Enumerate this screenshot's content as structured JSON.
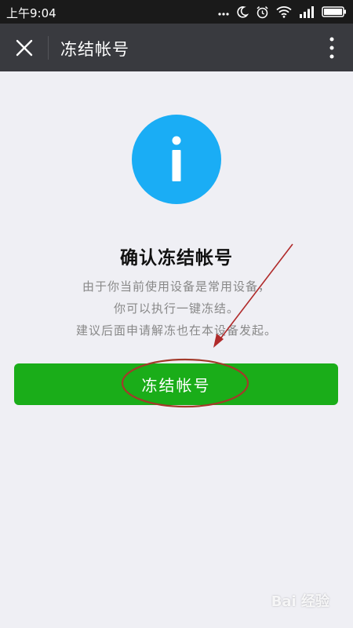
{
  "status_bar": {
    "time": "上午9:04",
    "icons": [
      "ellipsis-icon",
      "moon-icon",
      "alarm-icon",
      "wifi-icon",
      "signal-icon",
      "battery-icon"
    ]
  },
  "nav": {
    "title": "冻结帐号",
    "close_icon": "close-icon",
    "more_icon": "more-vertical-icon",
    "background": "#393a3f"
  },
  "main": {
    "icon": "info-icon",
    "icon_color": "#1aadf5",
    "heading": "确认冻结帐号",
    "description_lines": [
      "由于你当前使用设备是常用设备，",
      "你可以执行一键冻结。",
      "建议后面申请解冻也在本设备发起。"
    ],
    "button_label": "冻结帐号",
    "button_color": "#1aad19"
  },
  "annotation": {
    "color": "#b02a2a"
  },
  "watermark": {
    "text": "Bai 经验"
  }
}
